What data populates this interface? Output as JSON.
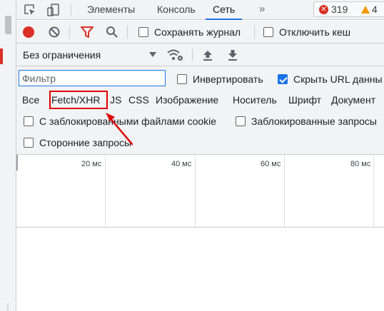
{
  "tabs": {
    "items": [
      {
        "label": "Элементы"
      },
      {
        "label": "Консоль"
      },
      {
        "label": "Сеть"
      }
    ],
    "more_label": "»",
    "errors_count": "319",
    "warnings_count": "4",
    "error_glyph": "✕"
  },
  "toolbar": {
    "preserve_log_label": "Сохранять журнал",
    "disable_cache_label": "Отключить кеш",
    "throttling_value": "Без ограничения"
  },
  "filter": {
    "placeholder": "Фильтр",
    "invert_label": "Инвертировать",
    "hide_data_urls_label": "Скрыть URL данны",
    "types": [
      {
        "label": "Все"
      },
      {
        "label": "Fetch/XHR"
      },
      {
        "label": "JS"
      },
      {
        "label": "CSS"
      },
      {
        "label": "Изображение"
      },
      {
        "label": "Носитель"
      },
      {
        "label": "Шрифт"
      },
      {
        "label": "Документ"
      }
    ],
    "blocked_cookies_label": "С заблокированными файлами cookie",
    "blocked_requests_label": "Заблокированные запросы",
    "third_party_label": "Сторонние запросы"
  },
  "timeline": {
    "ticks": [
      {
        "label": "20 мс"
      },
      {
        "label": "40 мс"
      },
      {
        "label": "60 мс"
      },
      {
        "label": "80 мс"
      }
    ]
  },
  "colors": {
    "accent": "#1a73e8",
    "record": "#d93025",
    "filter_icon": "#d93025",
    "highlight_box": "#e00000",
    "warning": "#f29900"
  }
}
